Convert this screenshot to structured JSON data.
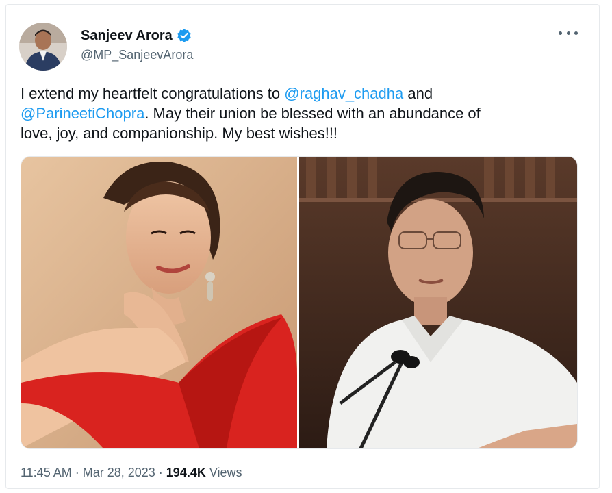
{
  "author": {
    "name": "Sanjeev Arora",
    "handle": "@MP_SanjeevArora",
    "verified": true
  },
  "tweet": {
    "mention1": "@raghav_chadha",
    "text1_pre": "I extend my heartfelt congratulations to ",
    "text1_post": " and",
    "mention2": "@ParineetiChopra",
    "text2_post": ". May their union be blessed with an abundance of",
    "text3": "love, joy, and companionship. My best wishes!!!"
  },
  "media": {
    "left_photo": "woman-in-red-dress-photo",
    "right_photo": "man-speaking-at-microphone-photo"
  },
  "meta": {
    "time": "11:45 AM",
    "sep": " · ",
    "date": "Mar 28, 2023",
    "views_count": "194.4K",
    "views_label": " Views"
  },
  "colors": {
    "link": "#1d9bf0",
    "text": "#0f1419",
    "secondary": "#536471"
  },
  "icons": [
    "verified-badge-icon",
    "more-options-icon"
  ]
}
